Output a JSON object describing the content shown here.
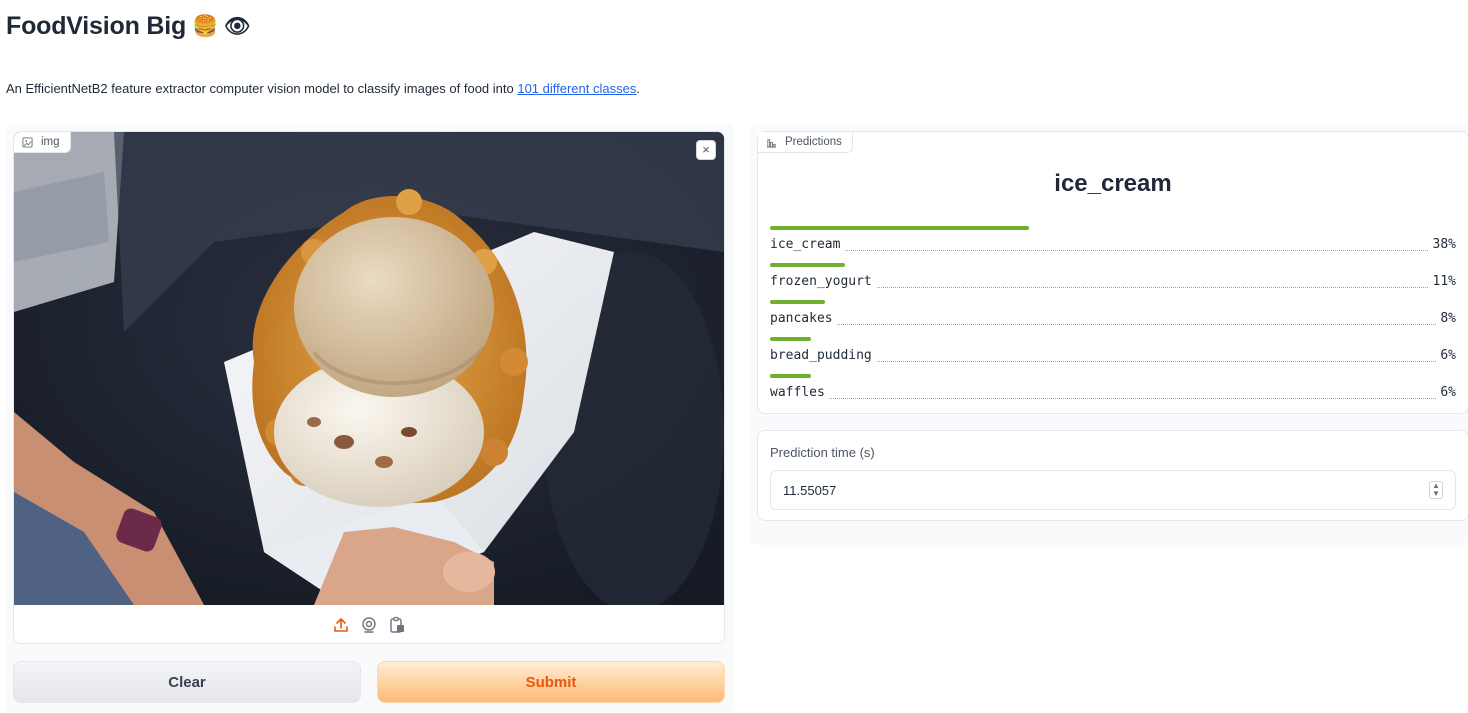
{
  "header": {
    "title": "FoodVision Big",
    "title_emoji_1": "🍔",
    "title_emoji_2": "👁",
    "description_prefix": "An EfficientNetB2 feature extractor computer vision model to classify images of food into ",
    "description_link": "101 different classes",
    "description_suffix": "."
  },
  "image_input": {
    "label": "img",
    "label_icon": "image-icon",
    "close_icon": "close-icon",
    "close_symbol": "×",
    "toolbar_icons": [
      "upload-icon",
      "webcam-icon",
      "clipboard-icon"
    ]
  },
  "buttons": {
    "clear_label": "Clear",
    "submit_label": "Submit"
  },
  "predictions": {
    "label": "Predictions",
    "label_icon": "bar-chart-icon",
    "top_class": "ice_cream",
    "items": [
      {
        "label": "ice_cream",
        "percent": "38%",
        "confidence": 0.38
      },
      {
        "label": "frozen_yogurt",
        "percent": "11%",
        "confidence": 0.11
      },
      {
        "label": "pancakes",
        "percent": "8%",
        "confidence": 0.08
      },
      {
        "label": "bread_pudding",
        "percent": "6%",
        "confidence": 0.06
      },
      {
        "label": "waffles",
        "percent": "6%",
        "confidence": 0.06
      }
    ],
    "bar_color": "#6fb02f"
  },
  "prediction_time": {
    "label": "Prediction time (s)",
    "value": "11.55057"
  },
  "colors": {
    "accent": "#ea580c",
    "link": "#2563eb"
  }
}
